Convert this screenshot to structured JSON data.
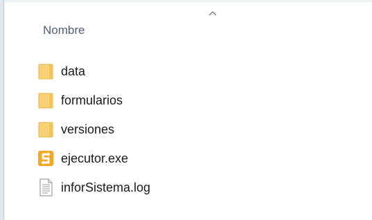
{
  "column": {
    "name_header": "Nombre",
    "sort_direction": "ascending"
  },
  "files": [
    {
      "name": "data",
      "type": "folder",
      "icon": "folder-icon"
    },
    {
      "name": "formularios",
      "type": "folder",
      "icon": "folder-icon"
    },
    {
      "name": "versiones",
      "type": "folder",
      "icon": "folder-icon"
    },
    {
      "name": "ejecutor.exe",
      "type": "application",
      "icon": "app-icon"
    },
    {
      "name": "inforSistema.log",
      "type": "text-document",
      "icon": "document-icon"
    }
  ],
  "colors": {
    "header_text": "#4c607a",
    "folder": "#f6d275",
    "app_orange": "#f5a623"
  }
}
